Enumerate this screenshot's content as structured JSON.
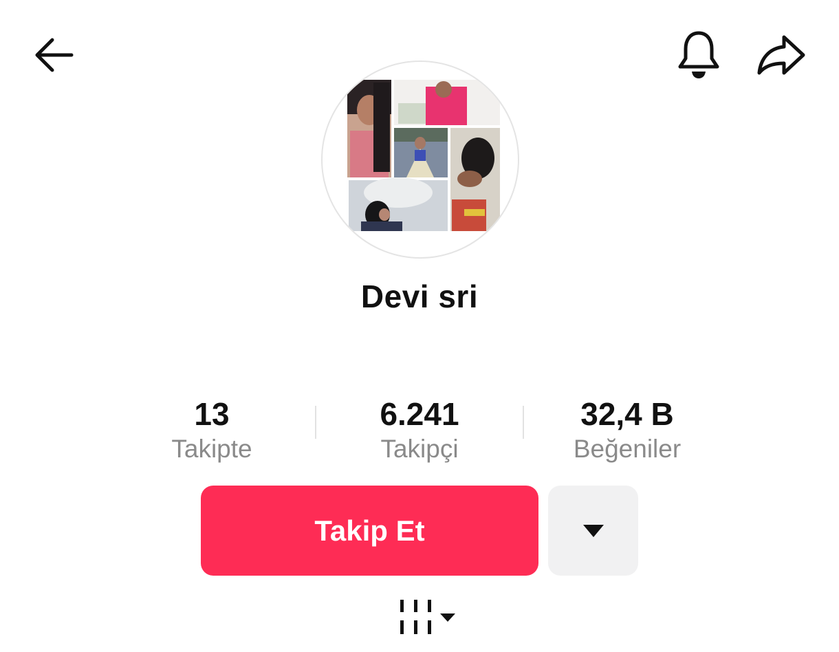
{
  "header": {
    "back_icon": "arrow-left-icon",
    "bell_icon": "bell-icon",
    "share_icon": "share-arrow-icon"
  },
  "profile": {
    "display_name": "Devi sri",
    "avatar_icon": "profile-photo-collage"
  },
  "stats": [
    {
      "value": "13",
      "label": "Takipte"
    },
    {
      "value": "6.241",
      "label": "Takipçi"
    },
    {
      "value": "32,4 B",
      "label": "Beğeniler"
    }
  ],
  "actions": {
    "follow_label": "Takip Et",
    "follow_color": "#fe2c55",
    "more_icon": "triangle-down-icon"
  },
  "view_toggle": {
    "icon": "grid-bars-dropdown-icon"
  }
}
